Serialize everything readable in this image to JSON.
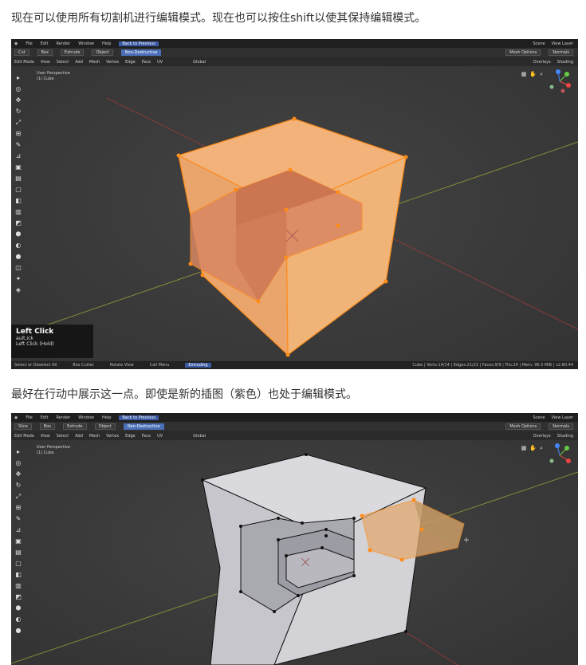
{
  "captions": {
    "first": "现在可以使用所有切割机进行编辑模式。现在也可以按住shift以使其保持编辑模式。",
    "second": "最好在行动中展示这一点。即使是新的插图（紫色）也处于编辑模式。"
  },
  "topbar": {
    "menus": [
      "File",
      "Edit",
      "Render",
      "Window",
      "Help"
    ],
    "back_label": "Back to Previous",
    "scene_label": "Scene",
    "view_layer_label": "View Layer"
  },
  "toolbar": {
    "cut_label": "Cut",
    "box_label": "Box",
    "extrude_label": "Extrude",
    "object_label": "Object",
    "non_destructive_label": "Non-Destructive",
    "slice_label": "Slice",
    "mesh_options_label": "Mesh Options",
    "normals_label": "Normals"
  },
  "headerbar": {
    "mode_label": "Edit Mode",
    "menus": [
      "View",
      "Select",
      "Add",
      "Mesh",
      "Vertex",
      "Edge",
      "Face",
      "UV"
    ],
    "global_label": "Global",
    "overlays_label": "Overlays",
    "shading_label": "Shading"
  },
  "viewport": {
    "perspective_label": "User Perspective",
    "object_label": "(1) Cube"
  },
  "overlay": {
    "title": "Left Click",
    "line1": "ault,ick",
    "line2": "Left Click (Hold)"
  },
  "statusbar": {
    "select_label": "Select or Deselect All",
    "box_cutter_label": "Box Cutter",
    "rotate_label": "Rotate View",
    "call_menu_label": "Call Menu",
    "mode_badge": "Extruding",
    "stats": "Cube | Verts:14/14 | Edges:21/21 | Faces:9/9 | Tris:24 | Mem: 96.5 MiB | v2.80.44"
  },
  "colors": {
    "selection_orange": "#ff8c1a",
    "face_fill": "#e8a36a",
    "insert_fill": "#d5855e",
    "mesh_gray": "#cfcfd4",
    "accent_blue": "#3b5aa3"
  }
}
